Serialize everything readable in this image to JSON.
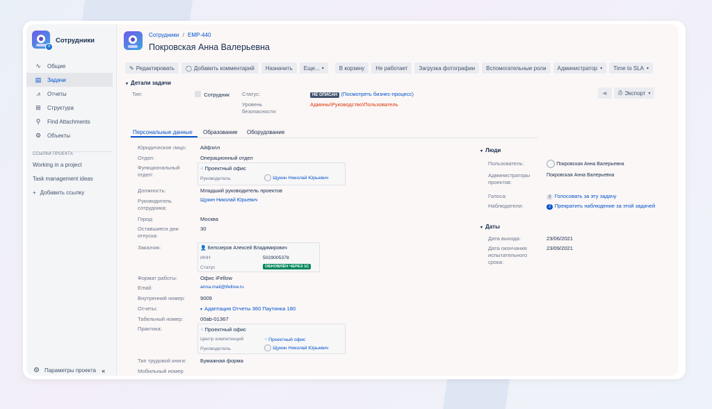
{
  "sidebar": {
    "title": "Сотрудники",
    "nav": [
      {
        "label": "Общие",
        "icon": "activity-icon"
      },
      {
        "label": "Задачи",
        "icon": "tasks-icon"
      },
      {
        "label": "Отчеты",
        "icon": "reports-icon"
      },
      {
        "label": "Структура",
        "icon": "structure-icon"
      },
      {
        "label": "Find Attachments",
        "icon": "search-icon"
      },
      {
        "label": "Объекты",
        "icon": "objects-icon"
      }
    ],
    "links_heading": "ССЫЛКИ ПРОЕКТА",
    "links": [
      "Working in a project",
      "Task management ideas"
    ],
    "add_link": "Добавить ссылку",
    "settings": "Параметры проекта"
  },
  "header": {
    "breadcrumb_project": "Сотрудники",
    "breadcrumb_sep": "/",
    "breadcrumb_issue": "EMP-440",
    "title": "Покровская Анна Валерьевна"
  },
  "toolbar": {
    "edit": "Редактировать",
    "comment": "Добавить комментарий",
    "assign": "Назначить",
    "more": "Еще...",
    "trash": "В корзину",
    "not_working": "Не работает",
    "photo": "Загрузка фотографии",
    "roles": "Вспомогательные роли",
    "admin": "Администратор",
    "sla": "Time to SLA",
    "export": "Экспорт"
  },
  "details": {
    "heading": "Детали задачи",
    "type_label": "Тип:",
    "type_value": "Сотрудник",
    "status_label": "Статус:",
    "status_badge": "НЕ ОПИСАН",
    "status_link": "(Посмотреть бизнес-процесс)",
    "security_label": "Уровень безопасности:",
    "security_value": "Админы\\Руководство\\Пользователь"
  },
  "tabs": [
    "Персональные данные",
    "Образование",
    "Оборудование"
  ],
  "fields": {
    "legal_entity_label": "Юридическое лицо:",
    "legal_entity": "Айфэлл",
    "department_label": "Отдел:",
    "department": "Операционный отдел",
    "func_dept_label": "Функциональный отдел:",
    "func_dept_card_title": "Проектный офис",
    "func_dept_card_role": "Руководитель",
    "func_dept_card_person": "Щукин Николай Юрьевич",
    "position_label": "Должность:",
    "position": "Младший руководитель проектов",
    "manager_label": "Руководитель сотрудника:",
    "manager": "Щукин Николай Юрьевич",
    "city_label": "Город:",
    "city": "Москва",
    "vacation_label": "Оставшиеся дни отпуска:",
    "vacation": "30",
    "customer_label": "Заказчик:",
    "customer_name": "Белозеров Алексей Владимирович",
    "customer_inn_label": "ИНН",
    "customer_inn": "5029005378",
    "customer_status_label": "Статус",
    "customer_status": "ОБНОВЛЁН ЧЕРЕЗ 1С",
    "work_format_label": "Формат работы:",
    "work_format": "Офис iFellow",
    "email_label": "Email:",
    "email": "anna.mail@ifellow.ru",
    "ext_label": "Внутренний номер:",
    "ext": "9009",
    "reports_label": "Отчеты:",
    "reports": "Адаптация Отчеты 360 Паутинка 180",
    "tab_no_label": "Табельный номер:",
    "tab_no": "00ab-01367",
    "practice_label": "Практика:",
    "practice_card_title": "Проектный офис",
    "practice_center_label": "Центр компетенций",
    "practice_center": "Проектный офис",
    "practice_role": "Руководитель",
    "practice_person": "Щукин Николай Юрьевич",
    "workbook_label": "Тип трудовой книги:",
    "workbook": "Бумажная форма",
    "mobile_label": "Мобильный номер"
  },
  "people": {
    "heading": "Люди",
    "user_label": "Пользователь:",
    "user": "Покровская Анна Валерьевна",
    "admins_label": "Администраторы проектов:",
    "admins": "Покровская Анна Валерьевна",
    "votes_label": "Голоса:",
    "votes_count": "0",
    "votes_link": "Голосовать за эту задачу",
    "watchers_label": "Наблюдатели:",
    "watchers_count": "2",
    "watchers_link": "Прекратить наблюдение за этой задачей"
  },
  "dates": {
    "heading": "Даты",
    "start_label": "Дата выхода:",
    "start": "23/06/2021",
    "probation_label": "Дата окончания испытательного срока:",
    "probation": "23/09/2021"
  }
}
